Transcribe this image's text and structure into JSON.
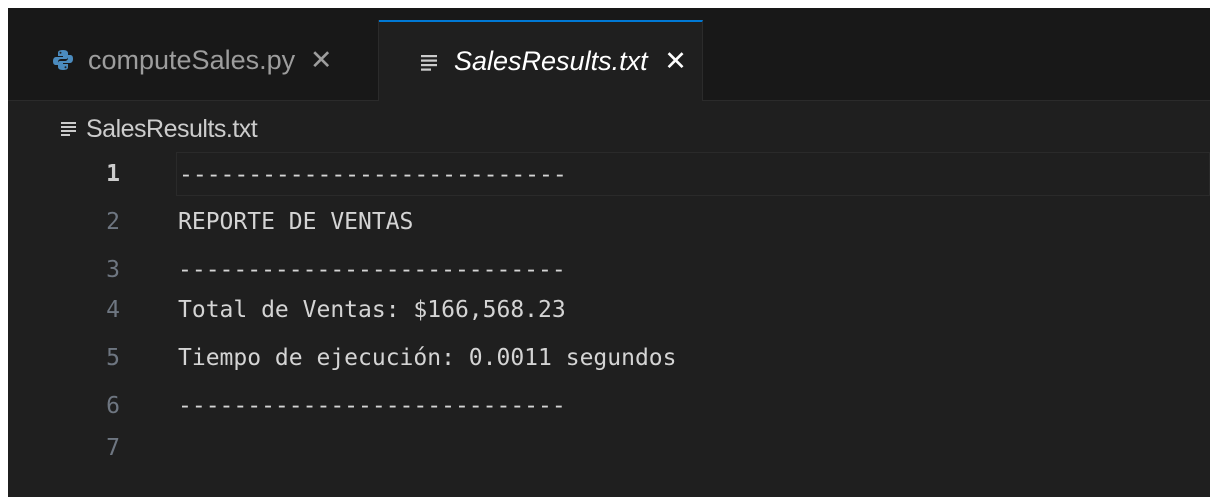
{
  "tabs": [
    {
      "label": "computeSales.py",
      "icon": "python-icon",
      "close": "✕",
      "active": false
    },
    {
      "label": "SalesResults.txt",
      "icon": "text-file-icon",
      "close": "✕",
      "active": true
    }
  ],
  "breadcrumb": {
    "label": "SalesResults.txt",
    "icon": "text-file-icon"
  },
  "editor": {
    "lines": [
      {
        "number": "1",
        "text": "----------------------------"
      },
      {
        "number": "2",
        "text": "REPORTE DE VENTAS"
      },
      {
        "number": "3",
        "text": "----------------------------"
      },
      {
        "number": "4",
        "text": "Total de Ventas: $166,568.23"
      },
      {
        "number": "5",
        "text": "Tiempo de ejecución: 0.0011 segundos"
      },
      {
        "number": "6",
        "text": "----------------------------"
      },
      {
        "number": "7",
        "text": ""
      }
    ],
    "current_line": "1"
  },
  "colors": {
    "background": "#1f1f1f",
    "tabbar": "#181818",
    "active_tab_border": "#0078d4",
    "python_icon": "#4b8bbe"
  }
}
